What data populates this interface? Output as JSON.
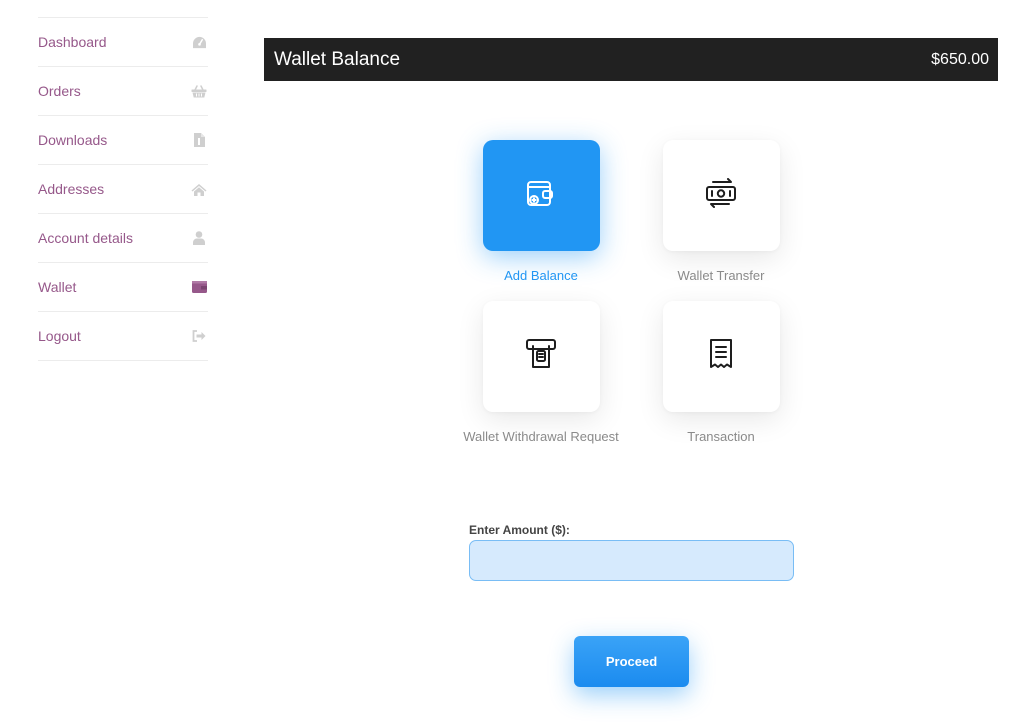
{
  "sidebar": {
    "items": [
      {
        "label": "Dashboard",
        "icon": "dashboard-gauge-icon"
      },
      {
        "label": "Orders",
        "icon": "basket-icon"
      },
      {
        "label": "Downloads",
        "icon": "file-download-icon"
      },
      {
        "label": "Addresses",
        "icon": "home-icon"
      },
      {
        "label": "Account details",
        "icon": "user-icon"
      },
      {
        "label": "Wallet",
        "icon": "wallet-icon",
        "active": true
      },
      {
        "label": "Logout",
        "icon": "sign-out-icon"
      }
    ]
  },
  "header": {
    "title": "Wallet Balance",
    "balance": "$650.00"
  },
  "actions": [
    {
      "label": "Add Balance",
      "icon": "wallet-add-icon",
      "active": true
    },
    {
      "label": "Wallet Transfer",
      "icon": "money-transfer-icon"
    },
    {
      "label": "Wallet Withdrawal Request",
      "icon": "atm-withdraw-icon"
    },
    {
      "label": "Transaction",
      "icon": "receipt-icon"
    }
  ],
  "form": {
    "amount_label": "Enter Amount ($):",
    "amount_value": "",
    "proceed_label": "Proceed"
  },
  "colors": {
    "accent": "#2196f3",
    "sidebar_link": "#96588a",
    "header_bg": "#212121"
  }
}
